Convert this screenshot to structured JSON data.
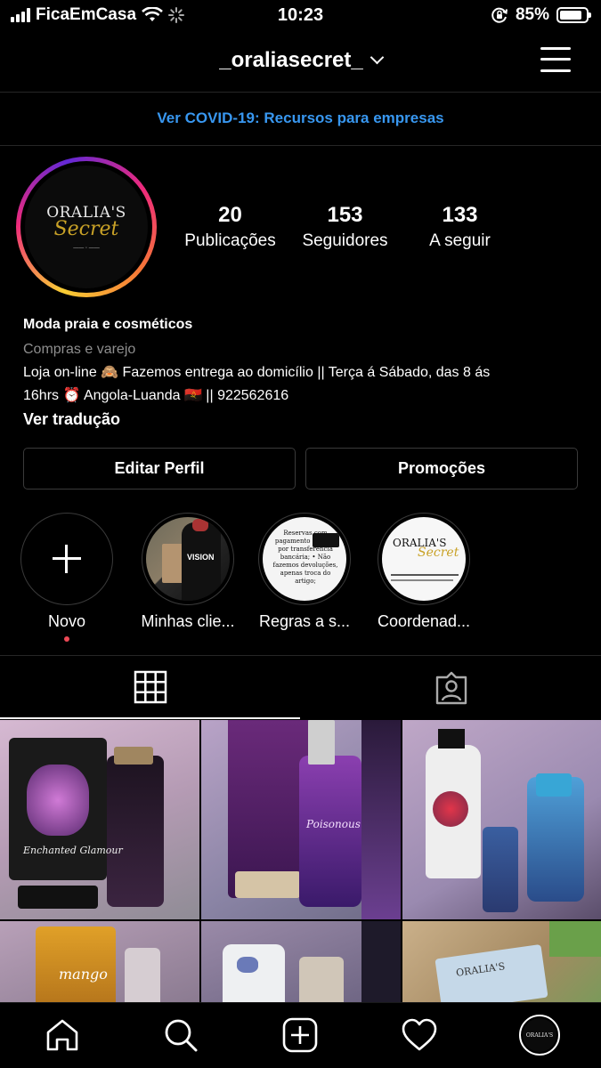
{
  "status_bar": {
    "carrier": "FicaEmCasa",
    "time": "10:23",
    "battery": "85%",
    "battery_level": 0.85
  },
  "header": {
    "username": "_oraliasecret_"
  },
  "banner": {
    "text": "Ver COVID-19: Recursos para empresas",
    "color": "#3897f0"
  },
  "profile": {
    "logo_name": "ORALIA'S",
    "logo_script": "Secret",
    "stats": [
      {
        "count": "20",
        "label": "Publicações"
      },
      {
        "count": "153",
        "label": "Seguidores"
      },
      {
        "count": "133",
        "label": "A seguir"
      }
    ]
  },
  "bio": {
    "name": "Moda praia e cosméticos",
    "category": "Compras e varejo",
    "line1": "Loja on-line 🙈 Fazemos entrega ao domicílio || Terça á Sábado, das 8 ás",
    "line2": "16hrs ⏰ Angola-Luanda 🇦🇴 || 922562616",
    "translate": "Ver tradução"
  },
  "buttons": {
    "edit": "Editar Perfil",
    "promo": "Promoções"
  },
  "highlights": [
    {
      "label": "Novo"
    },
    {
      "label": "Minhas clie..."
    },
    {
      "label": "Regras a s..."
    },
    {
      "label": "Coordenad..."
    }
  ],
  "posts": [
    {
      "caption": "Enchanted Glamour"
    },
    {
      "caption": "Poisonous Kiss"
    },
    {
      "caption": ""
    },
    {
      "caption": "mango"
    },
    {
      "caption": ""
    },
    {
      "caption": ""
    }
  ],
  "colors": {
    "accent": "#3897f0",
    "notification": "#ed4956",
    "post_bg": "#c9a7c9",
    "gold": "#c9a227"
  }
}
